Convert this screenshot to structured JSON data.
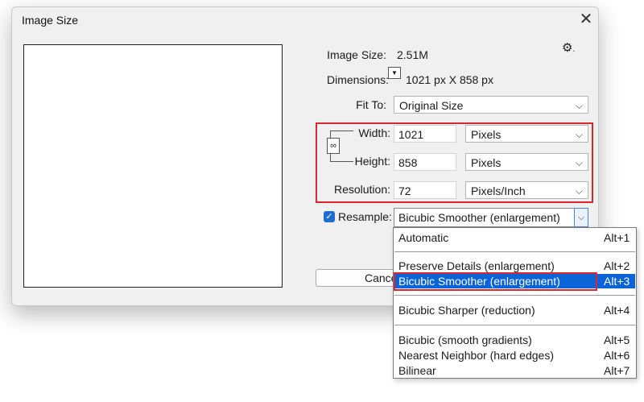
{
  "dialog": {
    "title": "Image Size",
    "close_glyph": "✕"
  },
  "info": {
    "image_size_label": "Image Size:",
    "image_size_value": "2.51M",
    "dimensions_label": "Dimensions:",
    "dimensions_value": "1021 px  X  858 px",
    "settings_glyph": "⚙"
  },
  "fit_to": {
    "label": "Fit To:",
    "value": "Original Size"
  },
  "fields": [
    {
      "label": "Width:",
      "value": "1021",
      "unit": "Pixels"
    },
    {
      "label": "Height:",
      "value": "858",
      "unit": "Pixels"
    },
    {
      "label": "Resolution:",
      "value": "72",
      "unit": "Pixels/Inch"
    }
  ],
  "resample": {
    "checked": true,
    "label": "Resample:",
    "value": "Bicubic Smoother (enlargement)"
  },
  "buttons": {
    "cancel": "Cancel"
  },
  "dropdown_options": [
    {
      "name": "Automatic",
      "key": "Alt+1"
    },
    {
      "name": "Preserve Details (enlargement)",
      "key": "Alt+2"
    },
    {
      "name": "Bicubic Smoother (enlargement)",
      "key": "Alt+3",
      "selected": true
    },
    {
      "name": "Bicubic Sharper (reduction)",
      "key": "Alt+4"
    },
    {
      "name": "Bicubic (smooth gradients)",
      "key": "Alt+5"
    },
    {
      "name": "Nearest Neighbor (hard edges)",
      "key": "Alt+6"
    },
    {
      "name": "Bilinear",
      "key": "Alt+7"
    }
  ],
  "colors": {
    "highlight": "#d7282f",
    "selection": "#0a64d8",
    "accent": "#1f6fd1"
  },
  "icons": {
    "close": "close-icon",
    "settings": "gear-icon",
    "link": "chain-link-icon",
    "chevron": "chevron-down-icon",
    "dimensions_toggle": "dimensions-dropdown-icon",
    "checkbox": "checkmark-icon"
  }
}
